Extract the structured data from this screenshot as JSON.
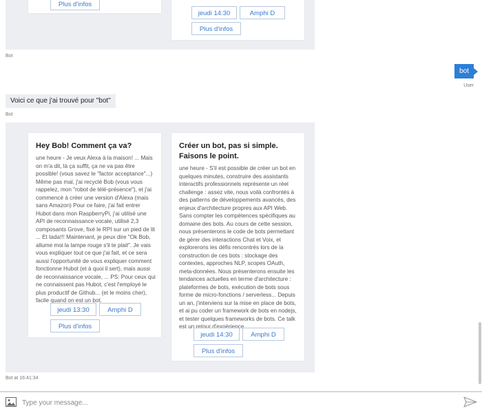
{
  "top_carousel": {
    "card_left": {
      "more_label": "Plus d'infos"
    },
    "card_right": {
      "time_label": "jeudi 14:30",
      "room_label": "Amphi D",
      "more_label": "Plus d'infos"
    }
  },
  "bot_label_1": "Bot",
  "user_message": {
    "text": "bot",
    "sender": "User"
  },
  "bot_message": {
    "text": "Voici ce que j'ai trouvé pour \"bot\"",
    "sender": "Bot"
  },
  "carousel": {
    "cards": [
      {
        "title": "Hey Bob! Comment ça va?",
        "text": "une heure - Je veux Alexa à la maison! ... Mais on m'a dit, là ça suffit, ça ne va pas être possible! (vous savez le \"factor acceptance\"...) Même pas mal, j'ai recyclé Bob (vous vous rappelez, mon \"robot de télé-présence\"), et j'ai commencé à créer une version d'Alexa (mais sans Amazon) Pour ce faire, j'ai fait entrer Hubot dans mon RaspberryPi, j'ai utilisé une API de reconnaissance vocale, utilisé 2,3 composants Grove, fixé le RPI sur un pied de lit ... Et tada!!! Maintenant, je peux dire \"Ok Bob, allume moi la lampe rouge s'il te plait\". Je vais vous expliquer tout ce que j'ai fait, et ce sera aussi l'opportunité de vous expliquer comment fonctionne Hubot (et à quoi il sert), mais aussi de reconnaissance vocale, ... PS: Pour ceux qui ne connaissent pas Hubot, c'est l'employé le plus productif de Github... (et le moins cher), facile quand on est un bot.",
        "time_label": "jeudi 13:30",
        "room_label": "Amphi D",
        "more_label": "Plus d'infos"
      },
      {
        "title": "Créer un bot, pas si simple. Faisons le point.",
        "text": "une heure - S'il est possible de créer un bot en quelques minutes, construire des assistants interactifs professionnels représente un réel challenge : assez vite, nous voilà confrontés à des patterns de développements avancés, des enjeux d'architecture propres aux API Web. Sans compter les compétences spécifiques au domaine des bots. Au cours de cette session, nous présenterons le code de bots permettant de gérer des interactions Chat et Voix, et explorerons les défis rencontrés lors de la construction de ces bots : stockage des contextes, approches NLP, scopes OAuth, meta-données. Nous présenterons ensuite les tendances actuelles en terme d'architecture : plateformes de bots, exécution de bots sous forme de micro-fonctions / serverless... Depuis un an, j'interviens sur la mise en place de bots, et ai pu coder un framework de bots en nodejs, et tester quelques frameworks de bots. Ce talk est un retour d'expérience.",
        "time_label": "jeudi 14:30",
        "room_label": "Amphi D",
        "more_label": "Plus d'infos"
      }
    ],
    "timestamp": "Bot at 16:41:34"
  },
  "composer": {
    "placeholder": "Type your message...",
    "attach_icon": "image-icon",
    "send_icon": "send-icon"
  },
  "colors": {
    "user_bubble": "#2d7fd6",
    "carousel_bg": "#eceef2",
    "button_text": "#3a78c9"
  }
}
